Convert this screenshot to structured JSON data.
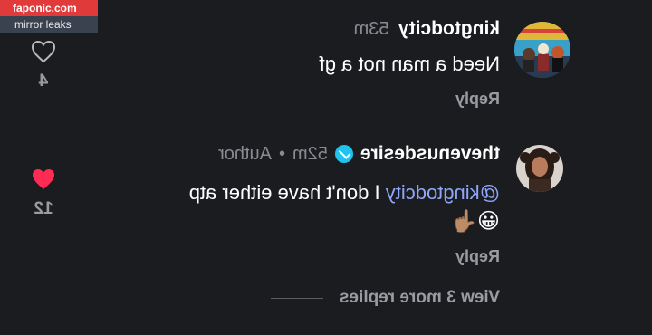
{
  "watermark": {
    "site": "faponic.com",
    "tag": "mirror leaks"
  },
  "comments": [
    {
      "username": "kingtodcity",
      "time": "53m",
      "text": "Need a man not a gf",
      "reply_label": "Reply",
      "likes": "4",
      "liked": false
    },
    {
      "username": "thevenusdesire",
      "time": "52m",
      "separator": "•",
      "author_badge": "Author",
      "mention": "@kingtodcity",
      "text": " I don't have either atp",
      "emoji_line": "😀👆🏽",
      "reply_label": "Reply",
      "likes": "12",
      "liked": true
    }
  ],
  "view_more": "View 3 more replies",
  "colors": {
    "background": "#1b1c20",
    "like_red": "#fe2c55",
    "mention": "#8ea5f8",
    "verified": "#20c2ef"
  }
}
